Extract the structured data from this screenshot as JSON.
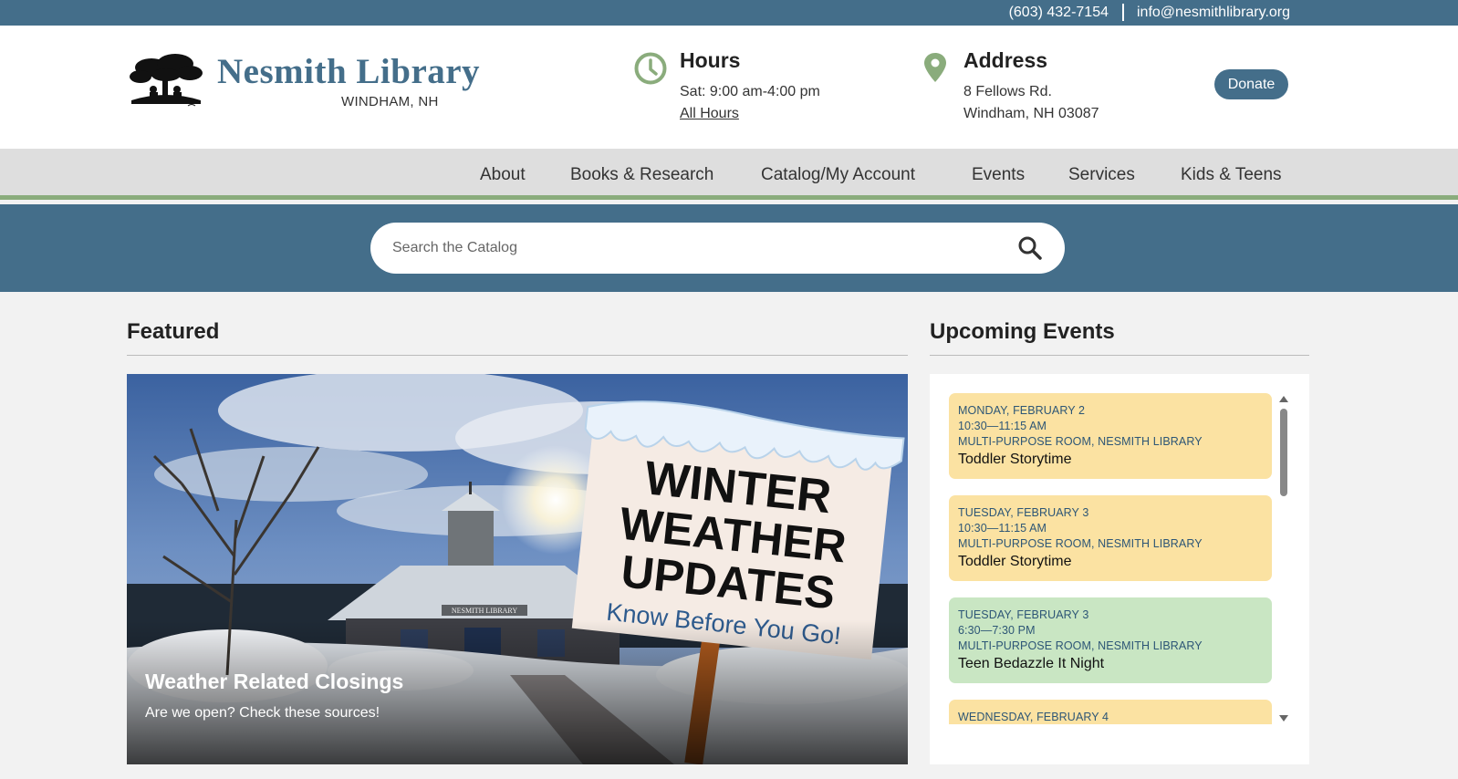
{
  "topbar": {
    "phone": "(603) 432-7154",
    "email": "info@nesmithlibrary.org"
  },
  "brand": {
    "name": "Nesmith Library",
    "location": "WINDHAM, NH"
  },
  "hours": {
    "title": "Hours",
    "today": "Sat: 9:00 am-4:00 pm",
    "link": "All Hours"
  },
  "address": {
    "title": "Address",
    "line1": "8 Fellows Rd.",
    "line2": "Windham, NH 03087"
  },
  "donate_label": "Donate",
  "nav": {
    "items": [
      "About",
      "Books & Research",
      "Catalog/My Account",
      "Events",
      "Services",
      "Kids & Teens"
    ]
  },
  "search": {
    "placeholder": "Search the Catalog"
  },
  "featured": {
    "heading": "Featured",
    "sign_line1": "WINTER",
    "sign_line2": "WEATHER",
    "sign_line3": "UPDATES",
    "sign_tagline": "Know Before You Go!",
    "building_sign": "NESMITH LIBRARY",
    "title": "Weather Related Closings",
    "subtitle": "Are we open? Check these sources!"
  },
  "events": {
    "heading": "Upcoming Events",
    "items": [
      {
        "date": "MONDAY, FEBRUARY 2",
        "time": "10:30—11:15 AM",
        "location": "MULTI-PURPOSE ROOM, NESMITH LIBRARY",
        "name": "Toddler Storytime"
      },
      {
        "date": "TUESDAY, FEBRUARY 3",
        "time": "10:30—11:15 AM",
        "location": "MULTI-PURPOSE ROOM, NESMITH LIBRARY",
        "name": "Toddler Storytime"
      },
      {
        "date": "TUESDAY, FEBRUARY 3",
        "time": "6:30—7:30 PM",
        "location": "MULTI-PURPOSE ROOM, NESMITH LIBRARY",
        "name": "Teen Bedazzle It Night"
      },
      {
        "date": "WEDNESDAY, FEBRUARY 4"
      }
    ]
  },
  "colors": {
    "brand_blue": "#446e8a",
    "accent_green": "#8aac7c",
    "event_yellow": "#fbe2a2",
    "event_green": "#c9e6c3"
  },
  "icons": {
    "hours": "clock-icon",
    "address": "map-pin-icon",
    "search": "search-icon",
    "logo": "tree-logo-icon"
  }
}
